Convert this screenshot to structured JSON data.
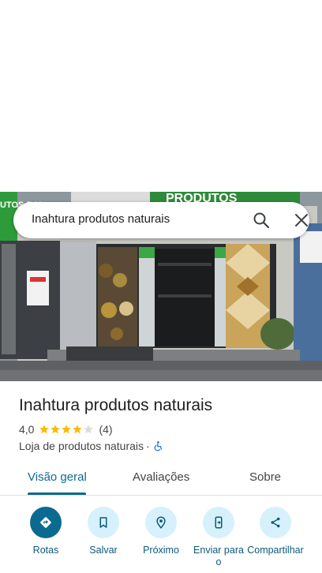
{
  "search": {
    "query": "Inahtura produtos naturais"
  },
  "photo": {
    "sign_text": "PRODUTOS",
    "left_sign_text": "UTOS RAI",
    "poster_text": "LOJA"
  },
  "place": {
    "name": "Inahtura produtos naturais",
    "rating": "4,0",
    "stars_filled": 4,
    "stars_total": 5,
    "review_count": "(4)",
    "category": "Loja de produtos naturais",
    "separator": "·"
  },
  "tabs": [
    {
      "label": "Visão geral",
      "active": true
    },
    {
      "label": "Avaliações",
      "active": false
    },
    {
      "label": "Sobre",
      "active": false
    }
  ],
  "actions": [
    {
      "label": "Rotas",
      "icon": "directions-icon"
    },
    {
      "label": "Salvar",
      "icon": "bookmark-icon"
    },
    {
      "label": "Próximo",
      "icon": "nearby-icon"
    },
    {
      "label": "Enviar para o",
      "icon": "send-to-phone-icon"
    },
    {
      "label": "Compartilhar",
      "icon": "share-icon"
    }
  ],
  "colors": {
    "accent": "#0b6a8f",
    "action_bg": "#d6f1fb",
    "star": "#fbbc04",
    "accessibility": "#1a73e8"
  }
}
